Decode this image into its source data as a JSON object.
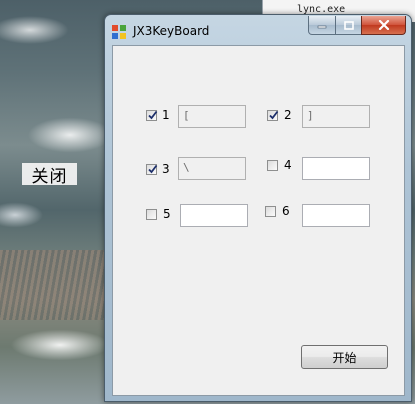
{
  "desktop": {
    "label": "关闭"
  },
  "background_window": {
    "text": "lync.exe"
  },
  "window": {
    "title": "JX3KeyBoard",
    "controls": {
      "minimize_icon": "minimize-icon",
      "maximize_icon": "maximize-icon",
      "close_icon": "close-icon"
    }
  },
  "keys": [
    {
      "label": "1",
      "checked": true,
      "value": "[",
      "enabled": false
    },
    {
      "label": "2",
      "checked": true,
      "value": "]",
      "enabled": false
    },
    {
      "label": "3",
      "checked": true,
      "value": "\\",
      "enabled": false
    },
    {
      "label": "4",
      "checked": false,
      "value": "",
      "enabled": true
    },
    {
      "label": "5",
      "checked": false,
      "value": "",
      "enabled": true
    },
    {
      "label": "6",
      "checked": false,
      "value": "",
      "enabled": true
    }
  ],
  "actions": {
    "start_label": "开始"
  },
  "colors": {
    "close_button": "#c0391f",
    "titlebar": "#aec4d6",
    "client_bg": "#f0f0f0"
  }
}
